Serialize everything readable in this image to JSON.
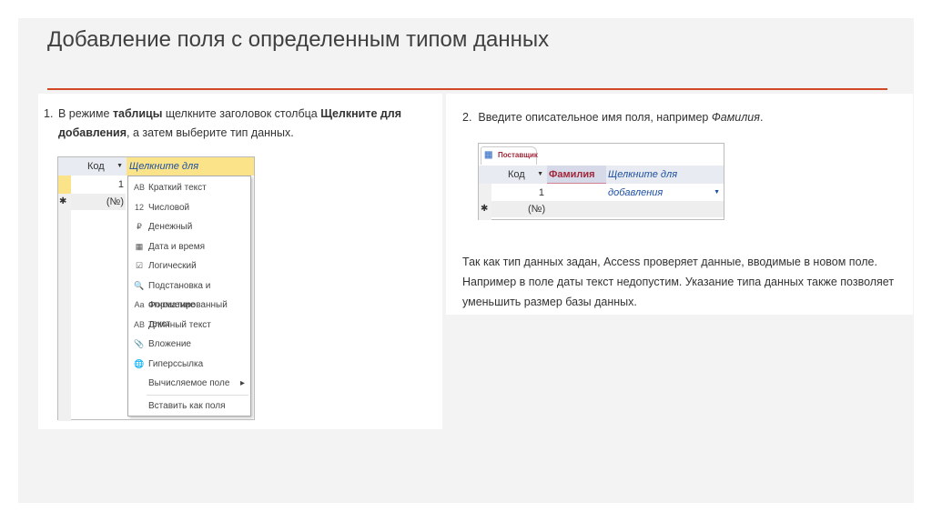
{
  "title": "Добавление поля с определенным типом данных",
  "step1": {
    "num": "1.",
    "pre": "В режиме ",
    "b1": "таблицы",
    "mid": " щелкните заголовок столбца ",
    "b2": "Щелкните для добавления",
    "post": ", а затем выберите тип данных."
  },
  "table1": {
    "col_code": "Код",
    "col_add": "Щелкните для добавления",
    "row1": "1",
    "new_row": "(№)",
    "new_marker": "✱",
    "menu": [
      {
        "icon": "AB",
        "label": "Краткий текст"
      },
      {
        "icon": "12",
        "label": "Числовой"
      },
      {
        "icon": "₽",
        "label": "Денежный"
      },
      {
        "icon": "▦",
        "label": "Дата и время"
      },
      {
        "icon": "☑",
        "label": "Логический"
      },
      {
        "icon": "🔍",
        "label": "Подстановка и отношение"
      },
      {
        "icon": "Aa",
        "label": "Форматированный текст"
      },
      {
        "icon": "AB",
        "label": "Длинный текст"
      },
      {
        "icon": "📎",
        "label": "Вложение"
      },
      {
        "icon": "🌐",
        "label": "Гиперссылка"
      },
      {
        "icon": "",
        "label": "Вычисляемое поле",
        "submenu": "▸"
      },
      {
        "icon": "",
        "label": "Вставить как поля"
      }
    ]
  },
  "step2": {
    "num": "2.",
    "text": "Введите описательное имя поля, например ",
    "em": "Фамилия",
    "end": "."
  },
  "table2": {
    "tab": "Поставщик",
    "col_code": "Код",
    "col_name": "Фамилия",
    "col_add": "Щелкните для добавления",
    "row1": "1",
    "new_row": "(№)",
    "new_marker": "✱"
  },
  "paragraph": "Так как тип данных задан, Access проверяет данные, вводимые в новом поле. Например в поле даты текст недопустим. Указание типа данных также позволяет уменьшить размер базы данных."
}
